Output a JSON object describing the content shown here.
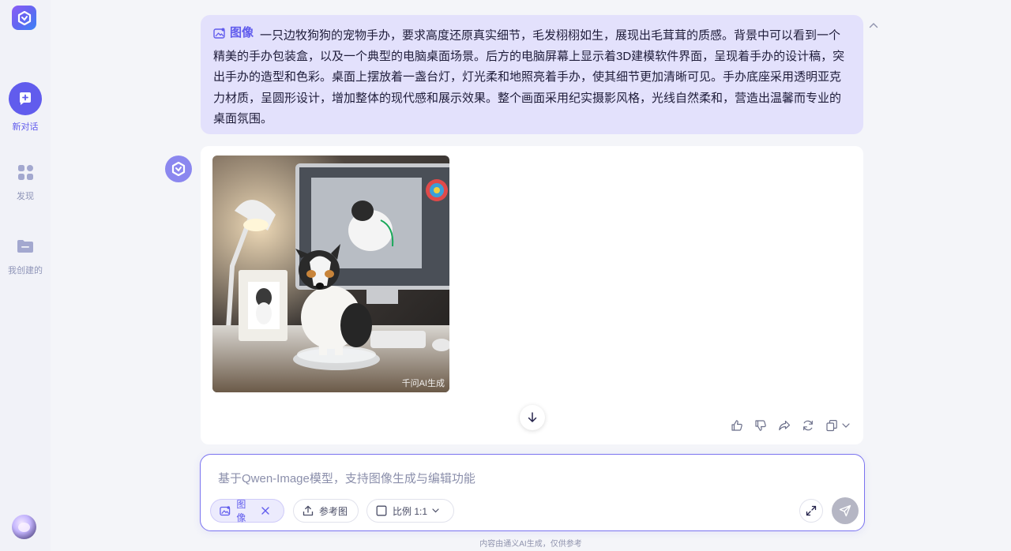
{
  "sidebar": {
    "new_chat": "新对话",
    "discover": "发现",
    "my_created": "我创建的"
  },
  "prompt": {
    "tag": "图像",
    "text": "一只边牧狗狗的宠物手办，要求高度还原真实细节，毛发栩栩如生，展现出毛茸茸的质感。背景中可以看到一个精美的手办包装盒，以及一个典型的电脑桌面场景。后方的电脑屏幕上显示着3D建模软件界面，呈现着手办的设计稿，突出手办的造型和色彩。桌面上摆放着一盏台灯，灯光柔和地照亮着手办，使其细节更加清晰可见。手办底座采用透明亚克力材质，呈圆形设计，增加整体的现代感和展示效果。整个画面采用纪实摄影风格，光线自然柔和，营造出温馨而专业的桌面氛围。"
  },
  "answer": {
    "watermark": "千问AI生成"
  },
  "input": {
    "placeholder": "基于Qwen-Image模型，支持图像生成与编辑功能",
    "chip_image": "图像",
    "chip_reference": "参考图",
    "chip_ratio": "比例 1:1"
  },
  "disclaimer": "内容由通义AI生成，仅供参考",
  "colors": {
    "accent": "#615ced",
    "bubble": "#e3e1fc"
  }
}
